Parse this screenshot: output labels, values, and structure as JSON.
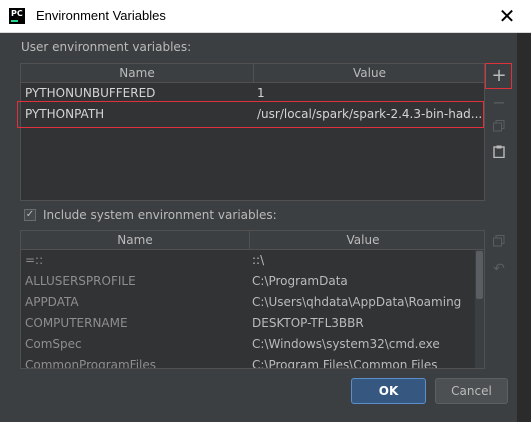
{
  "window": {
    "title": "Environment Variables",
    "app_icon_text": "PC"
  },
  "user_section": {
    "label": "User environment variables:",
    "columns": [
      "Name",
      "Value"
    ],
    "rows": [
      {
        "name": "PYTHONUNBUFFERED",
        "value": "1"
      },
      {
        "name": "PYTHONPATH",
        "value": "/usr/local/spark/spark-2.4.3-bin-had..."
      }
    ]
  },
  "toolbar_icons": [
    "add-icon",
    "remove-icon",
    "copy-icon",
    "paste-icon"
  ],
  "include_system": {
    "label": "Include system environment variables:",
    "checked": true
  },
  "system_section": {
    "columns": [
      "Name",
      "Value"
    ],
    "rows": [
      {
        "name": "=::",
        "value": "::\\"
      },
      {
        "name": "ALLUSERSPROFILE",
        "value": "C:\\ProgramData"
      },
      {
        "name": "APPDATA",
        "value": "C:\\Users\\qhdata\\AppData\\Roaming"
      },
      {
        "name": "COMPUTERNAME",
        "value": "DESKTOP-TFL3BBR"
      },
      {
        "name": "ComSpec",
        "value": "C:\\Windows\\system32\\cmd.exe"
      },
      {
        "name": "CommonProgramFiles",
        "value": "C:\\Program Files\\Common Files"
      }
    ]
  },
  "buttons": {
    "ok": "OK",
    "cancel": "Cancel"
  },
  "colors": {
    "highlight": "#e0303b",
    "dialog_bg": "#3c3f41",
    "ok_bg": "#365880"
  }
}
